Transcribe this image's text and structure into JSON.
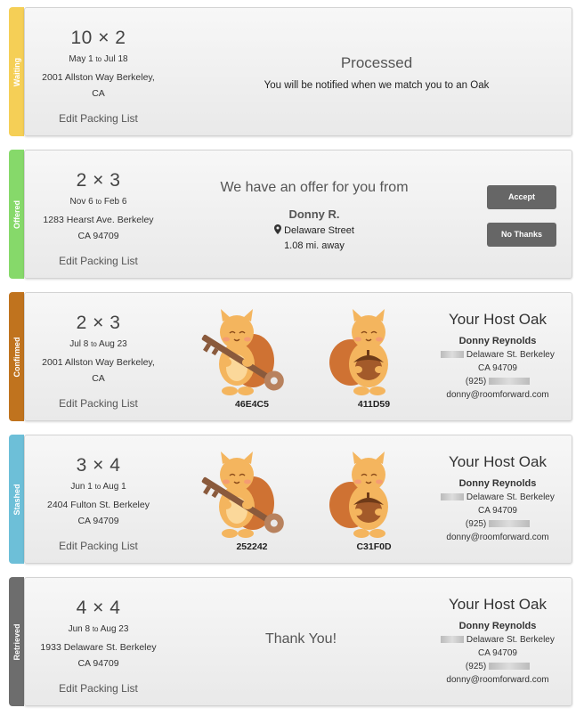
{
  "cards": [
    {
      "status": "Waiting",
      "status_color": "#f5cf56",
      "dims": "10 × 2",
      "start": "May 1",
      "to": "to",
      "end": "Jul 18",
      "addr1": "2001 Allston Way Berkeley,",
      "addr2": "CA",
      "edit": "Edit Packing List",
      "title": "Processed",
      "message": "You will be notified when we match you to an Oak"
    },
    {
      "status": "Offered",
      "status_color": "#86d96a",
      "dims": "2 × 3",
      "start": "Nov 6",
      "to": "to",
      "end": "Feb 6",
      "addr1": "1283 Hearst Ave. Berkeley",
      "addr2": "CA 94709",
      "edit": "Edit Packing List",
      "offer_title": "We have an offer for you from",
      "offer_name": "Donny R.",
      "offer_street": "Delaware Street",
      "offer_dist": "1.08 mi. away",
      "accept": "Accept",
      "decline": "No Thanks"
    },
    {
      "status": "Confirmed",
      "status_color": "#c0731e",
      "dims": "2 × 3",
      "start": "Jul 8",
      "to": "to",
      "end": "Aug 23",
      "addr1": "2001 Allston Way Berkeley,",
      "addr2": "CA",
      "edit": "Edit Packing List",
      "code1": "46E4C5",
      "code2": "411D59"
    },
    {
      "status": "Stashed",
      "status_color": "#6dbfd8",
      "dims": "3 × 4",
      "start": "Jun 1",
      "to": "to",
      "end": "Aug 1",
      "addr1": "2404 Fulton St. Berkeley",
      "addr2": "CA 94709",
      "edit": "Edit Packing List",
      "code1": "252242",
      "code2": "C31F0D"
    },
    {
      "status": "Retrieved",
      "status_color": "#6d6d6d",
      "dims": "4 × 4",
      "start": "Jun 8",
      "to": "to",
      "end": "Aug 23",
      "addr1": "1933 Delaware St. Berkeley",
      "addr2": "CA 94709",
      "edit": "Edit Packing List",
      "thanks": "Thank You!"
    }
  ],
  "host": {
    "title": "Your Host Oak",
    "name": "Donny Reynolds",
    "street": "Delaware St. Berkeley",
    "city": "CA 94709",
    "phone_prefix": "(925)",
    "email": "donny@roomforward.com"
  }
}
